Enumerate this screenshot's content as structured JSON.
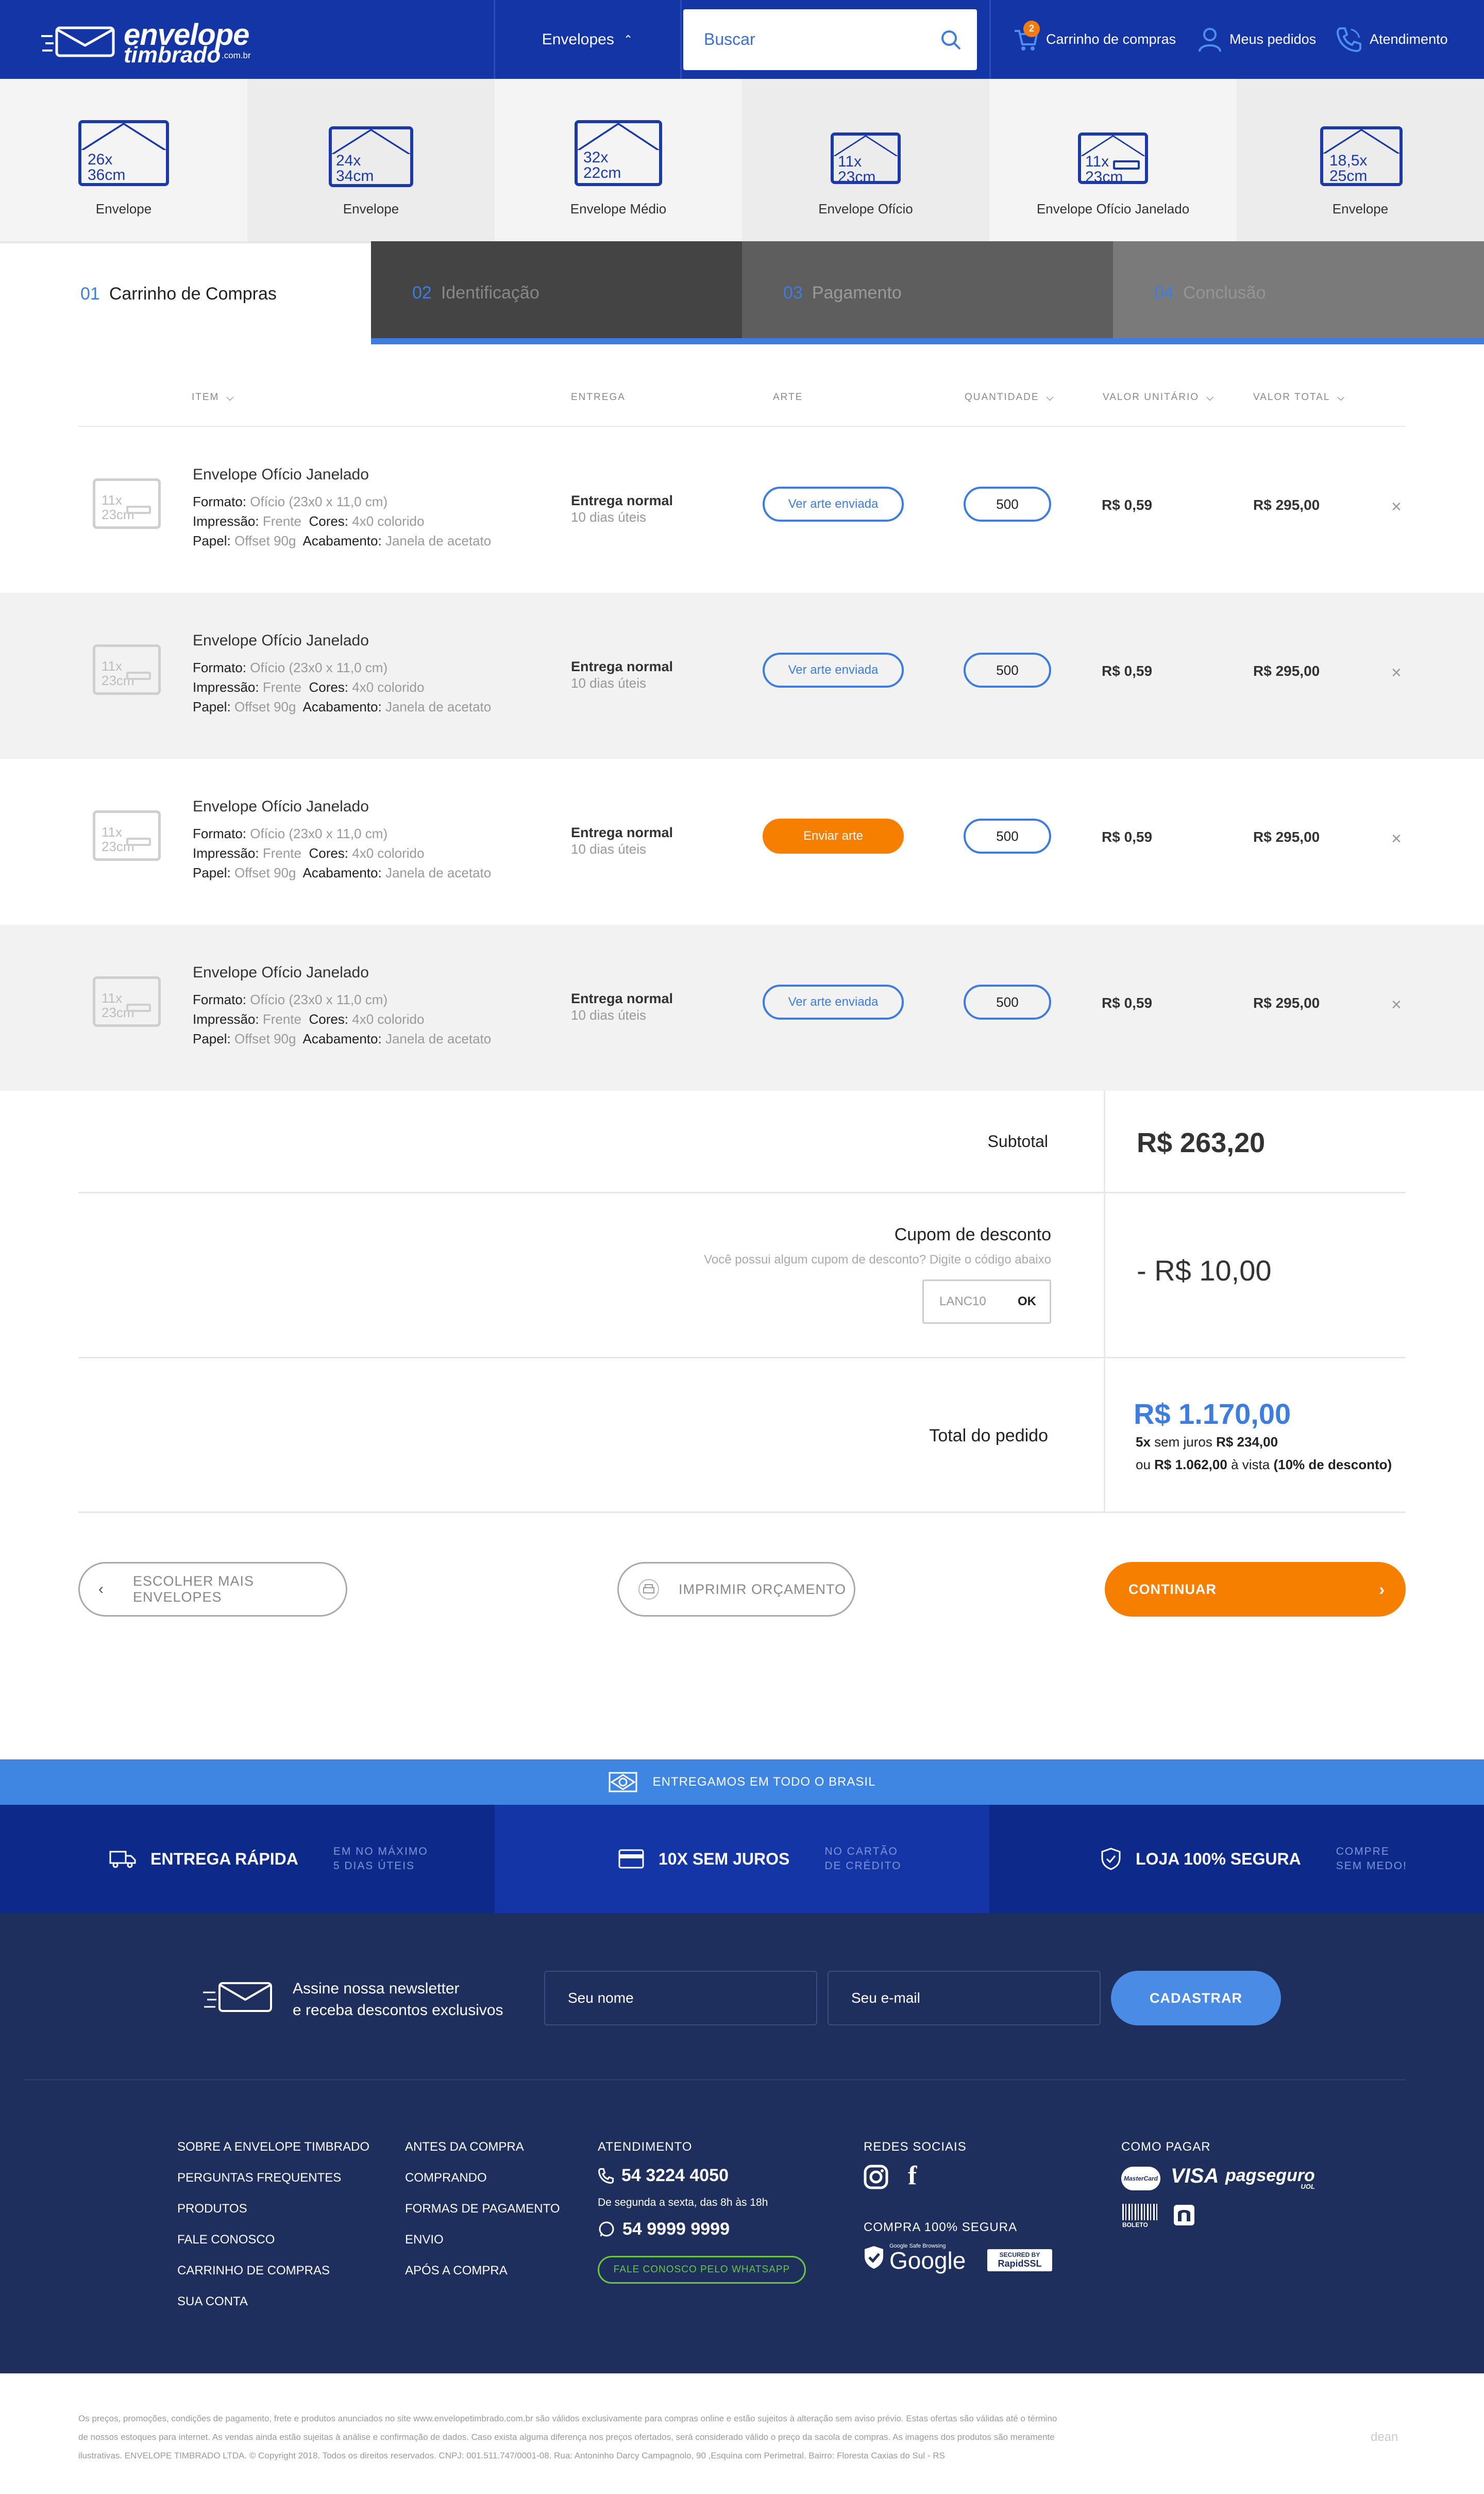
{
  "header": {
    "logo_line1": "envelope",
    "logo_line2": "timbrado",
    "logo_domain": ".com.br",
    "menu_label": "Envelopes",
    "search_placeholder": "Buscar",
    "cart_label": "Carrinho de compras",
    "cart_count": "2",
    "orders_label": "Meus pedidos",
    "support_label": "Atendimento"
  },
  "categories": [
    {
      "size": "26x\n36cm",
      "s1": "26x",
      "s2": "36cm",
      "label": "Envelope"
    },
    {
      "s1": "24x",
      "s2": "34cm",
      "label": "Envelope"
    },
    {
      "s1": "32x",
      "s2": "22cm",
      "label": "Envelope Médio"
    },
    {
      "s1": "11x",
      "s2": "23cm",
      "label": "Envelope Ofício"
    },
    {
      "s1": "11x",
      "s2": "23cm",
      "label": "Envelope Ofício Janelado"
    },
    {
      "s1": "18,5x",
      "s2": "25cm",
      "label": "Envelope"
    }
  ],
  "steps": [
    {
      "num": "01",
      "label": "Carrinho de Compras"
    },
    {
      "num": "02",
      "label": "Identificação"
    },
    {
      "num": "03",
      "label": "Pagamento"
    },
    {
      "num": "04",
      "label": "Conclusão"
    }
  ],
  "table": {
    "headers": {
      "item": "ITEM",
      "entrega": "ENTREGA",
      "arte": "ARTE",
      "quantidade": "QUANTIDADE",
      "unit": "VALOR UNITÁRIO",
      "total": "VALOR TOTAL"
    },
    "rows": [
      {
        "thumb1": "11x",
        "thumb2": "23cm",
        "name": "Envelope Ofício Janelado",
        "formato_k": "Formato:",
        "formato_v": "Ofício (23x0 x 11,0 cm)",
        "impressao_k": "Impressão:",
        "impressao_v": "Frente",
        "cores_k": "Cores:",
        "cores_v": "4x0 colorido",
        "papel_k": "Papel:",
        "papel_v": "Offset 90g",
        "acab_k": "Acabamento:",
        "acab_v": "Janela de acetato",
        "delivery": "Entrega normal",
        "delivery_days": "10 dias úteis",
        "art": "Ver arte enviada",
        "qty": "500",
        "unit": "R$ 0,59",
        "total": "R$ 295,00"
      },
      {
        "thumb1": "11x",
        "thumb2": "23cm",
        "name": "Envelope Ofício Janelado",
        "formato_k": "Formato:",
        "formato_v": "Ofício (23x0 x 11,0 cm)",
        "impressao_k": "Impressão:",
        "impressao_v": "Frente",
        "cores_k": "Cores:",
        "cores_v": "4x0 colorido",
        "papel_k": "Papel:",
        "papel_v": "Offset 90g",
        "acab_k": "Acabamento:",
        "acab_v": "Janela de acetato",
        "delivery": "Entrega normal",
        "delivery_days": "10 dias úteis",
        "art": "Ver arte enviada",
        "qty": "500",
        "unit": "R$ 0,59",
        "total": "R$ 295,00"
      },
      {
        "thumb1": "11x",
        "thumb2": "23cm",
        "name": "Envelope Ofício Janelado",
        "formato_k": "Formato:",
        "formato_v": "Ofício (23x0 x 11,0 cm)",
        "impressao_k": "Impressão:",
        "impressao_v": "Frente",
        "cores_k": "Cores:",
        "cores_v": "4x0 colorido",
        "papel_k": "Papel:",
        "papel_v": "Offset 90g",
        "acab_k": "Acabamento:",
        "acab_v": "Janela de acetato",
        "delivery": "Entrega normal",
        "delivery_days": "10 dias úteis",
        "art": "Enviar arte",
        "qty": "500",
        "unit": "R$ 0,59",
        "total": "R$ 295,00"
      },
      {
        "thumb1": "11x",
        "thumb2": "23cm",
        "name": "Envelope Ofício Janelado",
        "formato_k": "Formato:",
        "formato_v": "Ofício (23x0 x 11,0 cm)",
        "impressao_k": "Impressão:",
        "impressao_v": "Frente",
        "cores_k": "Cores:",
        "cores_v": "4x0 colorido",
        "papel_k": "Papel:",
        "papel_v": "Offset 90g",
        "acab_k": "Acabamento:",
        "acab_v": "Janela de acetato",
        "delivery": "Entrega normal",
        "delivery_days": "10 dias úteis",
        "art": "Ver arte enviada",
        "qty": "500",
        "unit": "R$ 0,59",
        "total": "R$ 295,00"
      }
    ]
  },
  "summary": {
    "subtotal_label": "Subtotal",
    "subtotal_value": "R$ 263,20",
    "coupon_title": "Cupom de desconto",
    "coupon_hint": "Você possui algum cupom de desconto? Digite o código abaixo",
    "coupon_code": "LANC10",
    "coupon_ok": "OK",
    "discount_value": "- R$ 10,00",
    "total_label": "Total do pedido",
    "total_value": "R$ 1.170,00",
    "inst_count": "5x",
    "inst_text": "sem juros",
    "inst_value": "R$ 234,00",
    "cash_prefix": "ou",
    "cash_value": "R$ 1.062,00",
    "cash_text": "à vista",
    "cash_discount": "(10% de desconto)"
  },
  "actions": {
    "more": "ESCOLHER MAIS ENVELOPES",
    "print": "IMPRIMIR ORÇAMENTO",
    "continue": "CONTINUAR"
  },
  "banner": {
    "ship": "ENTREGAMOS EM TODO O BRASIL",
    "f1_big": "ENTREGA RÁPIDA",
    "f1_s1": "EM NO MÁXIMO",
    "f1_s2": "5 DIAS ÚTEIS",
    "f2_big": "10X SEM JUROS",
    "f2_s1": "NO CARTÃO",
    "f2_s2": "DE CRÉDITO",
    "f3_big": "LOJA 100% SEGURA",
    "f3_s1": "COMPRE",
    "f3_s2": "SEM MEDO!"
  },
  "newsletter": {
    "line1": "Assine nossa newsletter",
    "line2": "e receba descontos exclusivos",
    "name_ph": "Seu nome",
    "email_ph": "Seu e-mail",
    "submit": "CADASTRAR"
  },
  "footer": {
    "col1": [
      "SOBRE A ENVELOPE TIMBRADO",
      "PERGUNTAS FREQUENTES",
      "PRODUTOS",
      "FALE CONOSCO",
      "CARRINHO DE COMPRAS",
      "SUA CONTA"
    ],
    "col2": [
      "ANTES DA COMPRA",
      "COMPRANDO",
      "FORMAS DE PAGAMENTO",
      "ENVIO",
      "APÓS A COMPRA"
    ],
    "att_title": "ATENDIMENTO",
    "phone1": "54 3224 4050",
    "hours": "De segunda a sexta, das 8h às 18h",
    "phone2": "54 9999 9999",
    "whatsapp": "FALE CONOSCO PELO WHATSAPP",
    "social_title": "REDES SOCIAIS",
    "secure_title": "COMPRA 100% SEGURA",
    "google_small": "Google Safe Browsing",
    "google": "Google",
    "rapid1": "SECURED BY",
    "rapid2": "RapidSSL",
    "pay_title": "COMO PAGAR",
    "mastercard": "MasterCard",
    "visa": "VISA",
    "pagseguro": "pagseguro",
    "pagseguro_sub": "UOL",
    "boleto": "BOLETO"
  },
  "legal": {
    "line1": "Os preços, promoções, condições de pagamento, frete e produtos anunciados no site www.envelopetimbrado.com.br são válidos exclusivamente para compras online e estão sujeitos à alteração sem aviso prévio. Estas ofertas são válidas até o término",
    "line2": "de nossos estoques para internet.  As vendas ainda estão sujeitas à análise e confirmação de dados. Caso exista alguma diferença nos preços ofertados, será considerado válido o preço da sacola de compras. As imagens dos produtos são meramente",
    "line3": "ilustrativas.  ENVELOPE TIMBRADO LTDA. © Copyright 2018. Todos os direitos reservados. CNPJ: 001.511.747/0001-08. Rua: Antoninho Darcy Campagnolo, 90 ,Esquina com Perimetral. Bairro: Floresta Caxias do Sul - RS",
    "credit": "dean"
  },
  "colors": {
    "primary": "#1435a6",
    "accent": "#3e7de0",
    "orange": "#f77f00",
    "footer": "#1f2f5d"
  }
}
